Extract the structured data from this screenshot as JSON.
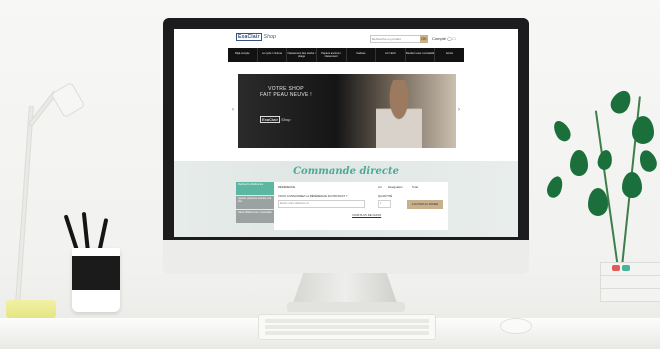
{
  "site": {
    "logo_main": "ExaClair",
    "logo_sub": "Shop",
    "search_placeholder": "Recherche un produit",
    "search_button": "OK",
    "account": "Compte"
  },
  "nav": [
    "Déjà compte",
    "Le cycle / cinéma",
    "Classement des stocks / pliage",
    "Papiers anciens / classement",
    "Cadeau",
    "Art / Ecrit",
    "Rendez-vous / consolidé",
    "Ecrire"
  ],
  "banner": {
    "line1": "VOTRE SHOP",
    "line2": "FAIT PEAU NEUVE !",
    "logo": "ExaClair",
    "logo_sub": "Shop",
    "prev": "‹",
    "next": "›"
  },
  "order": {
    "title": "Commande directe",
    "tabs": [
      "Recherche Référence",
      "Ajouter plusieurs articles à la fois",
      "Saisir Références / Quantités"
    ],
    "reference_label": "RÉFÉRENCE",
    "question": "VOUS CONNAISSEZ LA RÉFÉRENCE DU PRODUIT ?",
    "input_placeholder": "Entrez votre référence ici",
    "quantity_label": "QUANTITÉ",
    "quantity_value": "1",
    "cols": [
      "Art",
      "Désignation",
      "Total"
    ],
    "add_button": "AJOUTER AU PANIER",
    "more_link": "VOIR PLUS DE CHOIX"
  }
}
